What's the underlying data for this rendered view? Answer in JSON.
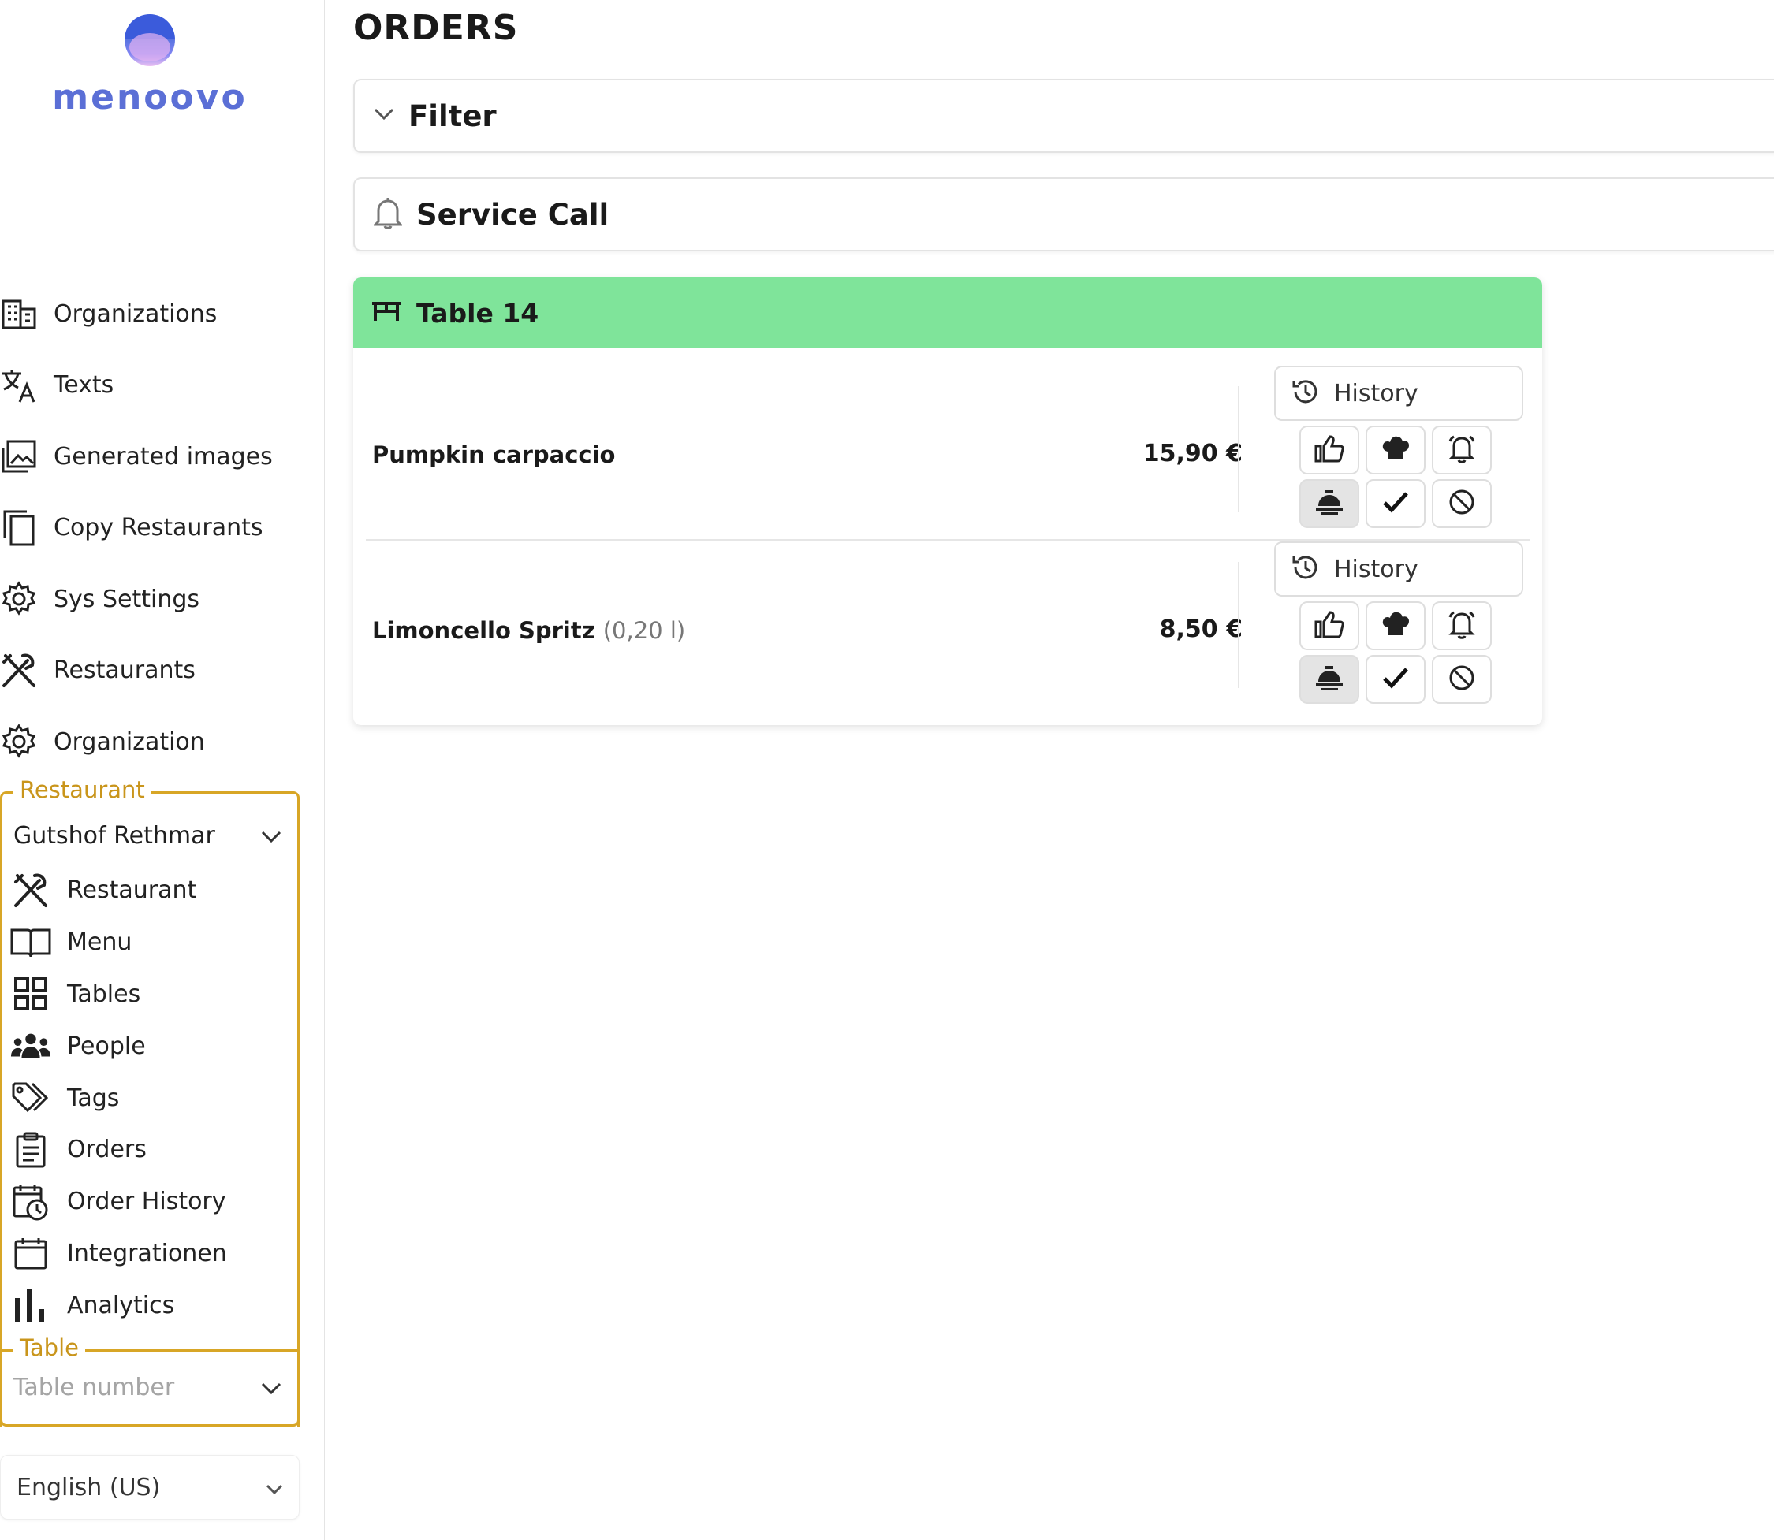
{
  "brand": {
    "name": "menoovo"
  },
  "nav": [
    {
      "label": "Organizations",
      "icon": "building-icon"
    },
    {
      "label": "Texts",
      "icon": "translate-icon"
    },
    {
      "label": "Generated images",
      "icon": "image-icon"
    },
    {
      "label": "Copy Restaurants",
      "icon": "copy-icon"
    },
    {
      "label": "Sys Settings",
      "icon": "gear-icon"
    },
    {
      "label": "Restaurants",
      "icon": "fork-knife-icon"
    },
    {
      "label": "Organization",
      "icon": "gear-icon"
    }
  ],
  "restaurant_section": {
    "legend": "Restaurant",
    "selected": "Gutshof Rethmar",
    "items": [
      {
        "label": "Restaurant",
        "icon": "fork-knife-icon"
      },
      {
        "label": "Menu",
        "icon": "book-icon"
      },
      {
        "label": "Tables",
        "icon": "grid-icon"
      },
      {
        "label": "People",
        "icon": "people-icon"
      },
      {
        "label": "Tags",
        "icon": "tags-icon"
      },
      {
        "label": "Orders",
        "icon": "clipboard-icon"
      },
      {
        "label": "Order History",
        "icon": "calendar-clock-icon"
      },
      {
        "label": "Integrationen",
        "icon": "calendar-icon"
      },
      {
        "label": "Analytics",
        "icon": "bar-chart-icon"
      }
    ]
  },
  "table_section": {
    "legend": "Table",
    "placeholder": "Table number"
  },
  "language": {
    "selected": "English (US)"
  },
  "main": {
    "title": "ORDERS",
    "filter_label": "Filter",
    "service_call_label": "Service Call",
    "table_card": {
      "title": "Table 14",
      "header_color": "#7fe49a",
      "orders": [
        {
          "name": "Pumpkin carpaccio",
          "quantity": "",
          "price": "15,90 €",
          "history_label": "History"
        },
        {
          "name": "Limoncello Spritz",
          "quantity": "(0,20 l)",
          "price": "8,50 €",
          "history_label": "History"
        }
      ]
    }
  },
  "colors": {
    "accent_gold": "#d8a626",
    "table_green": "#7fe49a",
    "brand_blue": "#5b6fd6"
  }
}
